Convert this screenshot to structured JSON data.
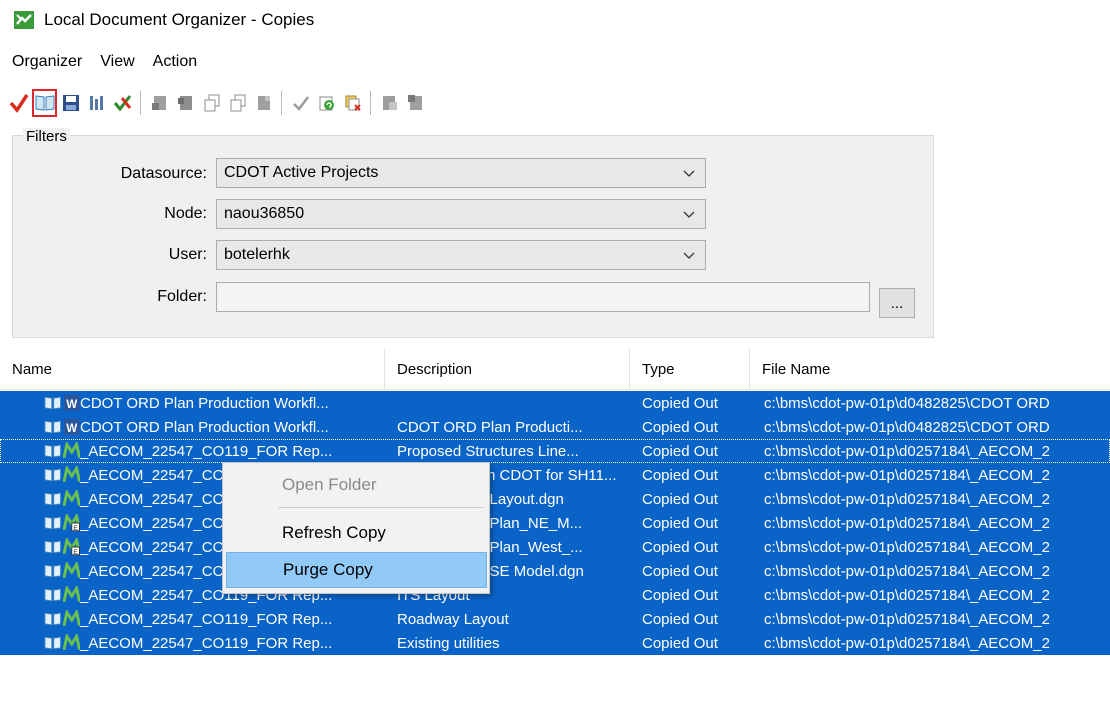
{
  "window": {
    "title": "Local Document Organizer - Copies"
  },
  "menu": [
    "Organizer",
    "View",
    "Action"
  ],
  "toolbar": {
    "icons": [
      "checkmark-icon",
      "open-book-icon",
      "save-icon",
      "columns-icon",
      "cancel-icon",
      "doc-icon",
      "doc-icon",
      "doc-copy-icon",
      "doc-copy-icon",
      "doc-icon",
      "check-icon",
      "refresh-icon",
      "purge-icon",
      "export-icon",
      "import-icon"
    ]
  },
  "filters": {
    "legend": "Filters",
    "datasource_label": "Datasource:",
    "datasource_value": "CDOT Active Projects",
    "node_label": "Node:",
    "node_value": "naou36850",
    "user_label": "User:",
    "user_value": "botelerhk",
    "folder_label": "Folder:",
    "folder_value": "",
    "browse_label": "..."
  },
  "list": {
    "columns": [
      "Name",
      "Description",
      "Type",
      "File Name"
    ],
    "rows": [
      {
        "type_icon": "word",
        "name": "CDOT ORD Plan Production Workfl...",
        "description": "",
        "type": "Copied Out",
        "file": "c:\\bms\\cdot-pw-01p\\d0482825\\CDOT ORD"
      },
      {
        "type_icon": "word",
        "name": "CDOT ORD Plan Production Workfl...",
        "description": "CDOT ORD Plan Producti...",
        "type": "Copied Out",
        "file": "c:\\bms\\cdot-pw-01p\\d0482825\\CDOT ORD"
      },
      {
        "type_icon": "dgn",
        "name": "_AECOM_22547_CO119_FOR Rep...",
        "description": "Proposed Structures Line...",
        "type": "Copied Out",
        "file": "c:\\bms\\cdot-pw-01p\\d0257184\\_AECOM_2"
      },
      {
        "type_icon": "dgn",
        "name": "_AECOM_22547_CO119_FOR Rep...",
        "description": "Model file from CDOT for SH11...",
        "type": "Copied Out",
        "file": "c:\\bms\\cdot-pw-01p\\d0257184\\_AECOM_2"
      },
      {
        "type_icon": "dgn",
        "name": "_AECOM_22547_CO119_FOR Rep...",
        "description": "22547HYDR_Layout.dgn",
        "type": "Copied Out",
        "file": "c:\\bms\\cdot-pw-01p\\d0257184\\_AECOM_2"
      },
      {
        "type_icon": "dgn-ref",
        "name": "_AECOM_22547_CO119_FOR Rep...",
        "description": "22547HYDR_Plan_NE_M...",
        "type": "Copied Out",
        "file": "c:\\bms\\cdot-pw-01p\\d0257184\\_AECOM_2"
      },
      {
        "type_icon": "dgn-ref",
        "name": "_AECOM_22547_CO119_FOR Rep...",
        "description": "22547HYDR_Plan_West_...",
        "type": "Copied Out",
        "file": "c:\\bms\\cdot-pw-01p\\d0257184\\_AECOM_2"
      },
      {
        "type_icon": "dgn",
        "name": "_AECOM_22547_CO119_FOR Rep...",
        "description": "22547HYDR_SE Model.dgn",
        "type": "Copied Out",
        "file": "c:\\bms\\cdot-pw-01p\\d0257184\\_AECOM_2"
      },
      {
        "type_icon": "dgn",
        "name": "_AECOM_22547_CO119_FOR Rep...",
        "description": "ITS Layout",
        "type": "Copied Out",
        "file": "c:\\bms\\cdot-pw-01p\\d0257184\\_AECOM_2"
      },
      {
        "type_icon": "dgn",
        "name": "_AECOM_22547_CO119_FOR Rep...",
        "description": "Roadway Layout",
        "type": "Copied Out",
        "file": "c:\\bms\\cdot-pw-01p\\d0257184\\_AECOM_2"
      },
      {
        "type_icon": "dgn",
        "name": "_AECOM_22547_CO119_FOR Rep...",
        "description": "Existing utilities",
        "type": "Copied Out",
        "file": "c:\\bms\\cdot-pw-01p\\d0257184\\_AECOM_2"
      }
    ]
  },
  "context_menu": {
    "items": [
      "Open Folder",
      "Refresh Copy",
      "Purge Copy"
    ]
  },
  "colors": {
    "selection": "#0a64c8",
    "menu_hover": "#91c9f7",
    "highlight_box": "#e0252b"
  }
}
